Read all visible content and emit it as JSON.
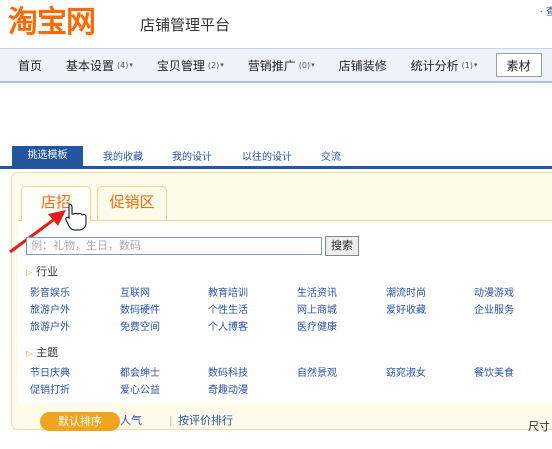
{
  "header": {
    "logo": "淘宝网",
    "subtitle": "店铺管理平台",
    "top_link": "· 查"
  },
  "nav": {
    "items": [
      {
        "label": "首页",
        "count": "",
        "has_arrow": false
      },
      {
        "label": "基本设置",
        "count": "(4)",
        "has_arrow": true
      },
      {
        "label": "宝贝管理",
        "count": "(2)",
        "has_arrow": true
      },
      {
        "label": "营销推广",
        "count": "(0)",
        "has_arrow": true
      },
      {
        "label": "店铺装修",
        "count": "",
        "has_arrow": false
      },
      {
        "label": "统计分析",
        "count": "(1)",
        "has_arrow": true
      },
      {
        "label": "素材",
        "count": "",
        "has_arrow": false
      }
    ],
    "arrow_glyph": "▾"
  },
  "subtabs": [
    "挑选模板",
    "我的收藏",
    "我的设计",
    "以往的设计",
    "交流"
  ],
  "panel": {
    "tabs": [
      "店招",
      "促销区"
    ],
    "search": {
      "placeholder": "例：礼物，生日，数码",
      "button": "搜索"
    },
    "sections": [
      {
        "title": "行业",
        "items": [
          "影音娱乐",
          "互联网",
          "教育培训",
          "生活资讯",
          "潮流时尚",
          "动漫游戏",
          "旅游户外",
          "数码硬件",
          "个性生活",
          "网上商城",
          "爱好收藏",
          "企业服务",
          "旅游户外",
          "免费空间",
          "个人博客",
          "医疗健康"
        ]
      },
      {
        "title": "主题",
        "items": [
          "节日庆典",
          "都会绅士",
          "数码科技",
          "自然景观",
          "窈窕淑女",
          "餐饮美食",
          "促销打折",
          "爱心公益",
          "奇趣动漫"
        ]
      }
    ],
    "sort": {
      "default": "默认排序",
      "popular": "人气",
      "separator": "|",
      "by_rating": "按评价排行"
    },
    "size_label": "尺寸"
  },
  "colors": {
    "brand": "#ff6a00",
    "link": "#2953a6",
    "tab_active": "#2355a0",
    "panel_bg": "#fffbea",
    "sort_button": "#f0a420",
    "annotation_arrow": "#e0201a"
  }
}
